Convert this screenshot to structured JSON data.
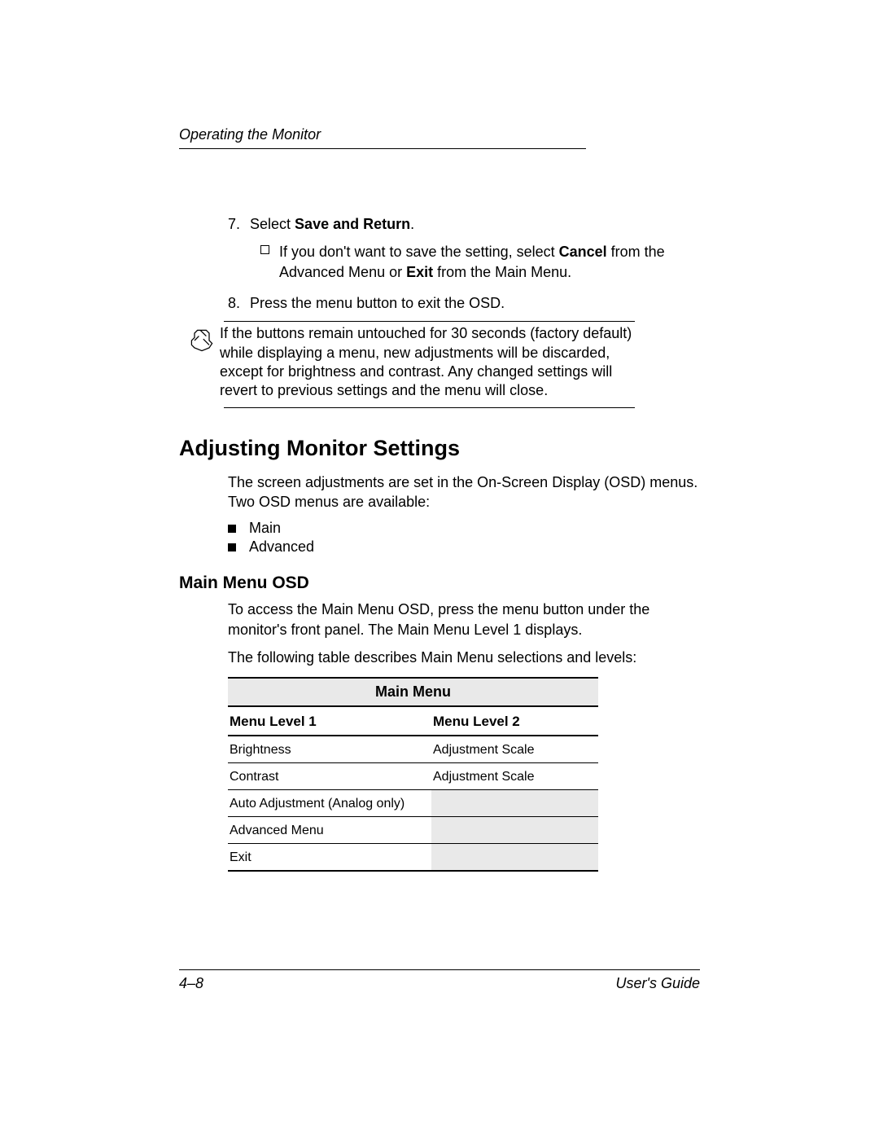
{
  "running_head": "Operating the Monitor",
  "step7": {
    "num": "7.",
    "prefix": "Select ",
    "bold": "Save and Return",
    "suffix": "."
  },
  "step7_sub": {
    "p1": "If you don't want to save the setting, select ",
    "b1": "Cancel",
    "p2": " from the Advanced Menu or ",
    "b2": "Exit",
    "p3": " from the Main Menu."
  },
  "step8": {
    "num": "8.",
    "text": "Press the menu button to exit the OSD."
  },
  "note": "If the buttons remain untouched for 30 seconds (factory default) while displaying a menu, new adjustments will be discarded, except for brightness and contrast. Any changed settings will revert to previous settings and the menu will close.",
  "h2": "Adjusting Monitor Settings",
  "intro": "The screen adjustments are set in the On-Screen Display (OSD) menus. Two OSD menus are available:",
  "bullets": [
    "Main",
    "Advanced"
  ],
  "h3": "Main Menu OSD",
  "h3_p1": "To access the Main Menu OSD, press the menu button under the monitor's front panel. The Main Menu Level 1 displays.",
  "h3_p2": "The following table describes Main Menu selections and levels:",
  "table": {
    "title": "Main Menu",
    "col1": "Menu Level 1",
    "col2": "Menu Level 2",
    "rows": [
      {
        "c1": "Brightness",
        "c2": "Adjustment Scale"
      },
      {
        "c1": "Contrast",
        "c2": "Adjustment Scale"
      },
      {
        "c1": "Auto Adjustment (Analog only)",
        "c2": ""
      },
      {
        "c1": "Advanced Menu",
        "c2": ""
      },
      {
        "c1": "Exit",
        "c2": ""
      }
    ]
  },
  "footer": {
    "left": "4–8",
    "right": "User's Guide"
  }
}
